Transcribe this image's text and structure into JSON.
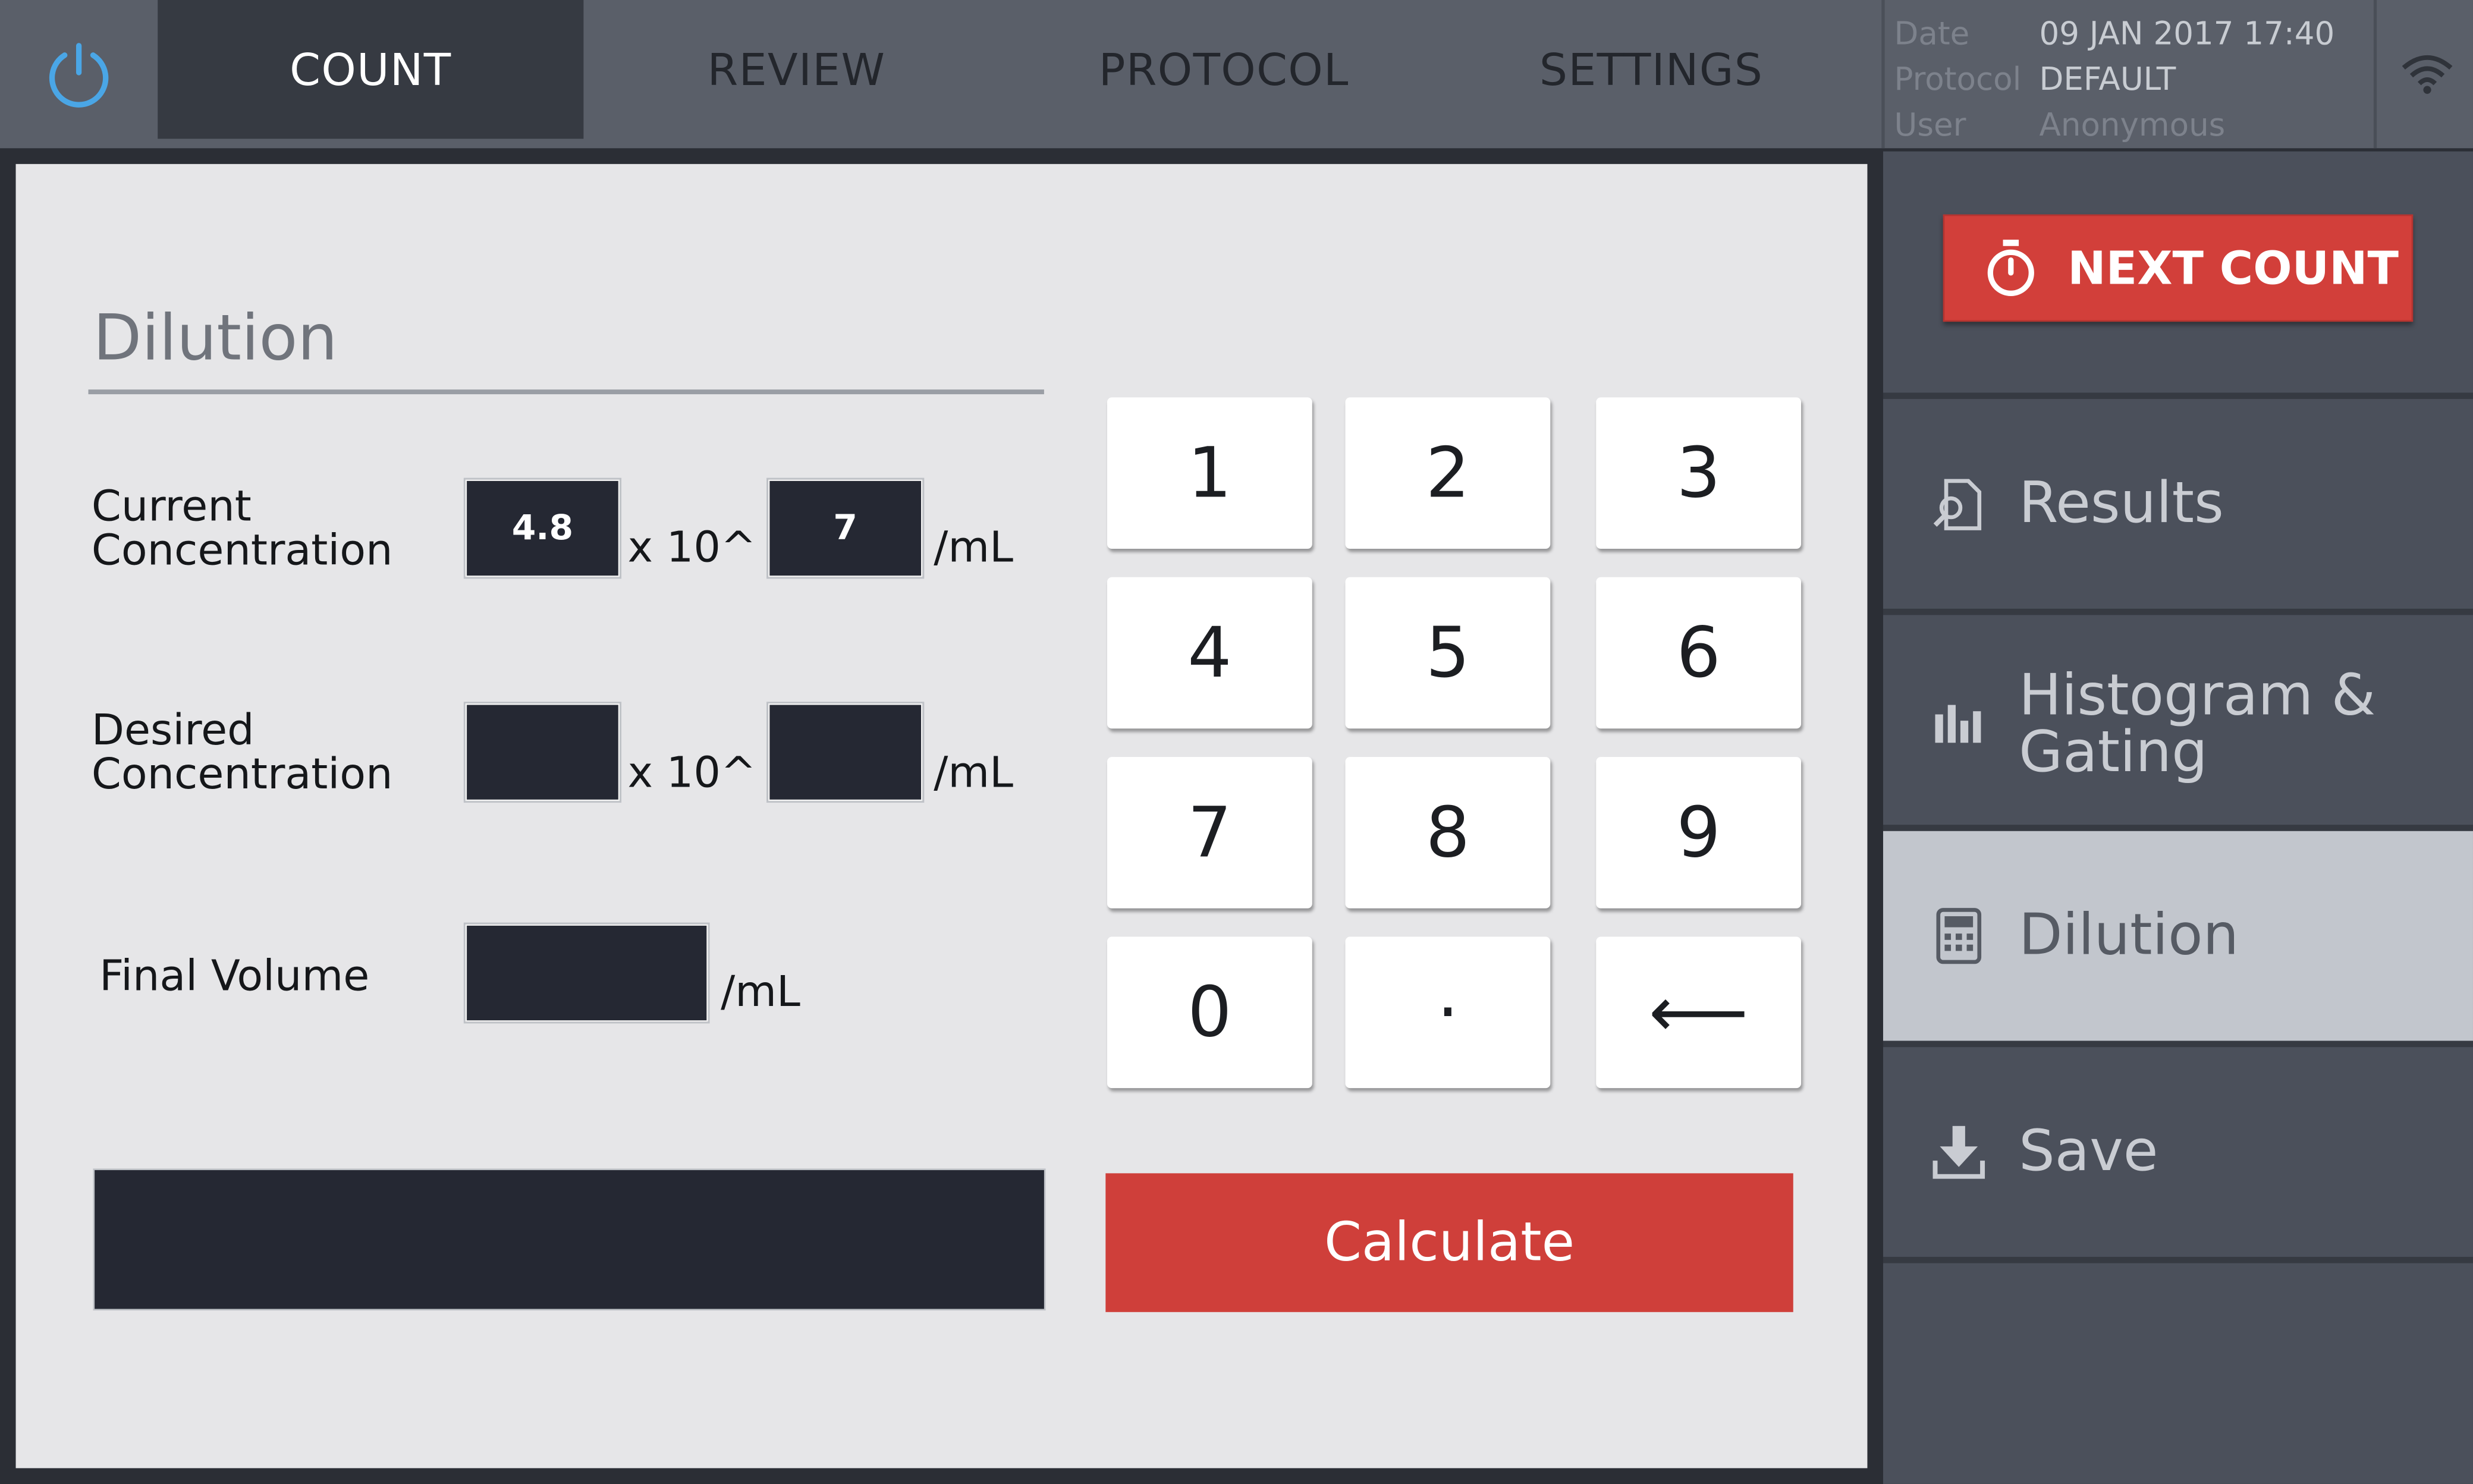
{
  "topbar": {
    "tabs": [
      {
        "label": "COUNT",
        "active": true
      },
      {
        "label": "REVIEW",
        "active": false
      },
      {
        "label": "PROTOCOL",
        "active": false
      },
      {
        "label": "SETTINGS",
        "active": false
      }
    ],
    "status": {
      "date_label": "Date",
      "date_value": "09  JAN  2017  17:40",
      "protocol_label": "Protocol",
      "protocol_value": "DEFAULT",
      "user_label": "User",
      "user_value": "Anonymous"
    },
    "icons": {
      "power": "power-icon",
      "wifi": "wifi-icon"
    }
  },
  "dilution": {
    "title": "Dilution",
    "current": {
      "label_line1": "Current",
      "label_line2": "Concentration",
      "mantissa": "4.8",
      "multiplier": "x 10^",
      "exponent": "7",
      "unit": "/mL"
    },
    "desired": {
      "label_line1": "Desired",
      "label_line2": "Concentration",
      "mantissa": "",
      "multiplier": "x 10^",
      "exponent": "",
      "unit": "/mL"
    },
    "final_volume": {
      "label": "Final Volume",
      "value": "",
      "unit": "/mL"
    },
    "result": ""
  },
  "keypad": {
    "keys": [
      "1",
      "2",
      "3",
      "4",
      "5",
      "6",
      "7",
      "8",
      "9",
      "0",
      "·",
      "⟵"
    ],
    "calculate_label": "Calculate"
  },
  "sidebar": {
    "next_count_label": "NEXT COUNT",
    "items": [
      {
        "label_line1": "Results",
        "label_line2": "",
        "icon": "results-icon",
        "active": false
      },
      {
        "label_line1": "Histogram &",
        "label_line2": "Gating",
        "icon": "histogram-icon",
        "active": false
      },
      {
        "label_line1": "Dilution",
        "label_line2": "",
        "icon": "calculator-icon",
        "active": true
      },
      {
        "label_line1": "Save",
        "label_line2": "",
        "icon": "download-icon",
        "active": false
      }
    ]
  },
  "colors": {
    "topbar": "#5a5f69",
    "active_tab": "#363a42",
    "panel": "#e6e6e8",
    "input_box": "#252833",
    "accent_red": "#d23f3a",
    "sidebar": "#4b505b",
    "sidebar_active": "#c2c6cd"
  }
}
